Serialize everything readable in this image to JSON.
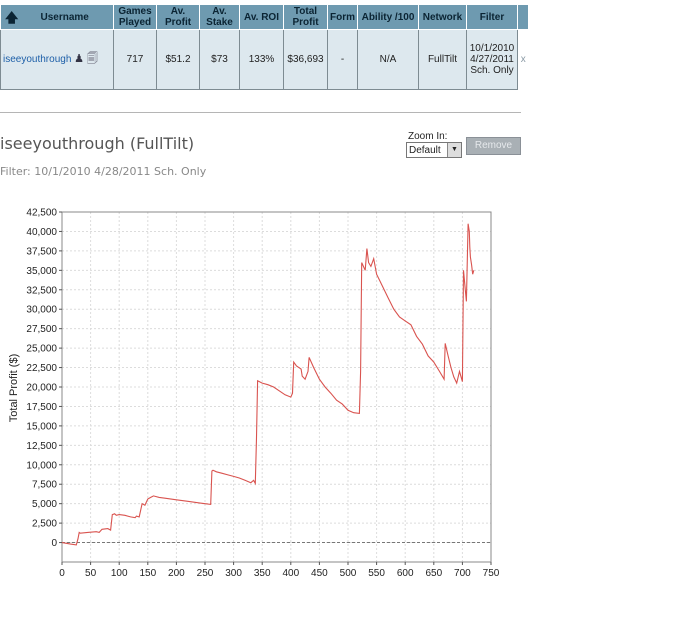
{
  "table": {
    "headers": [
      "Username",
      "Games Played",
      "Av. Profit",
      "Av. Stake",
      "Av. ROI",
      "Total Profit",
      "Form",
      "Ability /100",
      "Network",
      "Filter"
    ],
    "row": {
      "username": "iseeyouthrough",
      "games_played": "717",
      "av_profit": "$51.2",
      "av_stake": "$73",
      "av_roi": "133%",
      "total_profit": "$36,693",
      "form": "-",
      "ability": "N/A",
      "network": "FullTilt",
      "filter_line1": "10/1/2010",
      "filter_line2": "4/27/2011",
      "filter_line3": "Sch. Only",
      "remove": "x"
    },
    "header_color": "#6e9ab0",
    "row_color": "#dde8ee"
  },
  "panel": {
    "title": "iseeyouthrough (FullTilt)",
    "filter_text": "Filter: 10/1/2010 4/28/2011 Sch. Only",
    "zoom_label": "Zoom In:",
    "zoom_value": "Default",
    "remove_button": "Remove"
  },
  "chart_data": {
    "type": "line",
    "title": "",
    "xlabel": "",
    "ylabel": "Total Profit ($)",
    "xlim": [
      0,
      750
    ],
    "ylim": [
      -2500,
      42500
    ],
    "x_ticks": [
      0,
      50,
      100,
      150,
      200,
      250,
      300,
      350,
      400,
      450,
      500,
      550,
      600,
      650,
      700,
      750
    ],
    "y_ticks": [
      0,
      2500,
      5000,
      7500,
      10000,
      12500,
      15000,
      17500,
      20000,
      22500,
      25000,
      27500,
      30000,
      32500,
      35000,
      37500,
      40000,
      42500
    ],
    "grid": true,
    "line_color": "#d9534f",
    "series": [
      {
        "x": [
          0,
          15,
          25,
          28,
          30,
          32,
          45,
          60,
          65,
          70,
          80,
          85,
          88,
          92,
          95,
          100,
          110,
          120,
          128,
          130,
          135,
          140,
          145,
          150,
          155,
          160,
          170,
          180,
          200,
          220,
          240,
          250,
          260,
          262,
          264,
          270,
          280,
          290,
          300,
          310,
          320,
          330,
          335,
          338,
          340,
          342,
          350,
          360,
          370,
          380,
          390,
          400,
          403,
          405,
          410,
          418,
          420,
          425,
          430,
          432,
          440,
          450,
          460,
          470,
          480,
          490,
          500,
          510,
          520,
          522,
          524,
          530,
          533,
          536,
          540,
          545,
          550,
          560,
          570,
          580,
          590,
          600,
          610,
          620,
          630,
          640,
          650,
          660,
          668,
          670,
          675,
          680,
          685,
          690,
          695,
          700,
          702,
          705,
          707,
          710,
          712,
          713,
          714,
          716,
          718,
          720
        ],
        "y": [
          0,
          -200,
          -300,
          500,
          1300,
          1200,
          1300,
          1400,
          1300,
          1700,
          1800,
          1600,
          3600,
          3700,
          3500,
          3600,
          3500,
          3300,
          3200,
          3400,
          3300,
          5000,
          4800,
          5600,
          5800,
          6000,
          5800,
          5700,
          5500,
          5300,
          5100,
          5000,
          4900,
          9200,
          9300,
          9100,
          8900,
          8700,
          8500,
          8300,
          8000,
          7700,
          8000,
          7600,
          13500,
          20800,
          20500,
          20300,
          20000,
          19500,
          19000,
          18700,
          19200,
          23200,
          22700,
          22300,
          21400,
          21000,
          22000,
          23800,
          22500,
          21000,
          20000,
          19200,
          18300,
          17800,
          17000,
          16700,
          16600,
          22000,
          36000,
          35000,
          37800,
          36000,
          35500,
          36500,
          34500,
          33000,
          31500,
          30000,
          29000,
          28500,
          28000,
          26500,
          25500,
          24000,
          23200,
          22000,
          21000,
          25600,
          24000,
          22500,
          21300,
          20500,
          22000,
          20700,
          35000,
          32500,
          31000,
          41000,
          40000,
          38000,
          36700,
          35700,
          34500,
          35000
        ]
      }
    ]
  }
}
